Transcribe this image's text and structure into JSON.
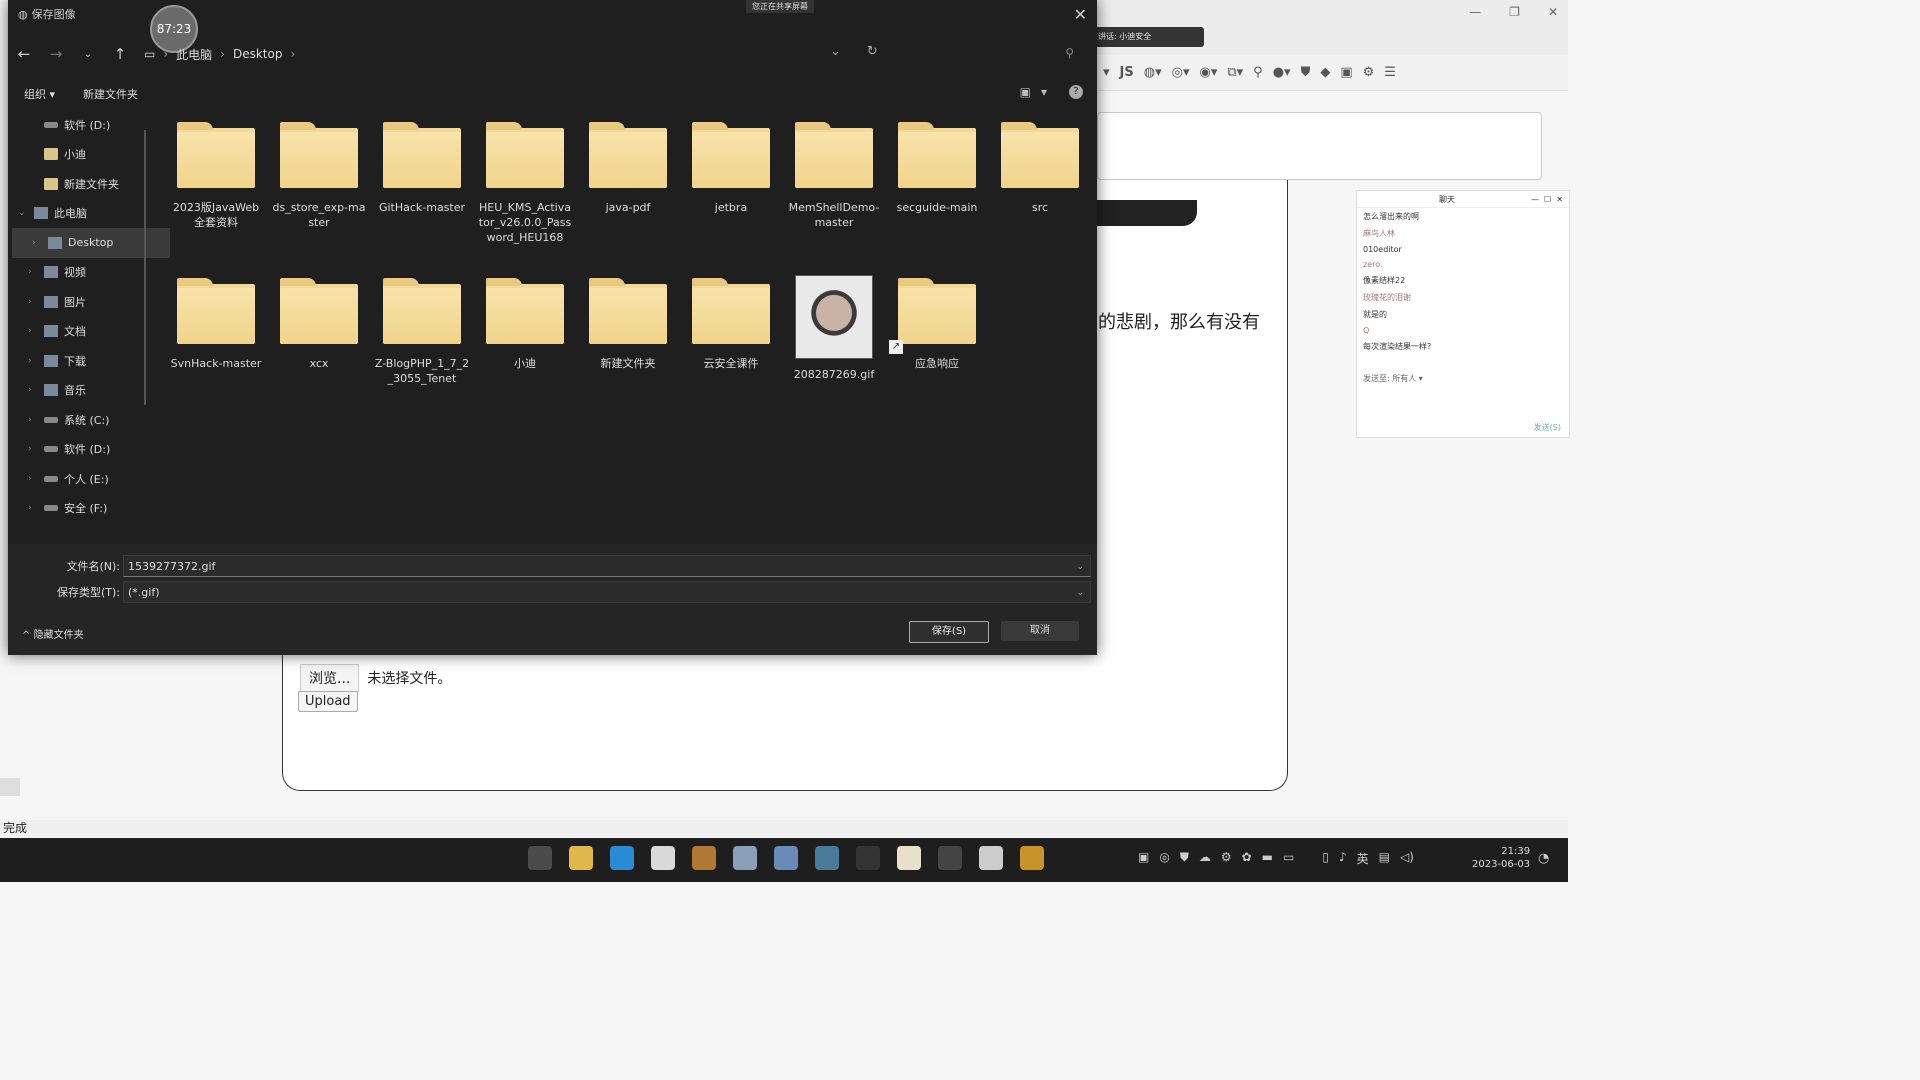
{
  "dialog": {
    "title": "保存图像",
    "timer": "87:23",
    "share_banner": "您正在共享屏幕",
    "breadcrumb": [
      "此电脑",
      "Desktop"
    ],
    "toolbar": {
      "organize": "组织 ▾",
      "new_folder": "新建文件夹"
    },
    "sidebar": [
      {
        "label": "软件 (D:)",
        "icon": "drive-icon",
        "indent": 1
      },
      {
        "label": "小迪",
        "icon": "folder-icon",
        "indent": 1
      },
      {
        "label": "新建文件夹",
        "icon": "folder-icon",
        "indent": 1
      },
      {
        "label": "此电脑",
        "icon": "computer-icon",
        "indent": 0,
        "expanded": true
      },
      {
        "label": "Desktop",
        "icon": "desktop-icon",
        "indent": 1,
        "selected": true
      },
      {
        "label": "视频",
        "icon": "video-icon",
        "indent": 1
      },
      {
        "label": "图片",
        "icon": "picture-icon",
        "indent": 1
      },
      {
        "label": "文档",
        "icon": "document-icon",
        "indent": 1
      },
      {
        "label": "下载",
        "icon": "download-icon",
        "indent": 1
      },
      {
        "label": "音乐",
        "icon": "music-icon",
        "indent": 1
      },
      {
        "label": "系统 (C:)",
        "icon": "drive-icon",
        "indent": 1
      },
      {
        "label": "软件 (D:)",
        "icon": "drive-icon",
        "indent": 1
      },
      {
        "label": "个人 (E:)",
        "icon": "drive-icon",
        "indent": 1
      },
      {
        "label": "安全 (F:)",
        "icon": "drive-icon",
        "indent": 1
      }
    ],
    "files": [
      {
        "name": "2023版JavaWeb全套资料",
        "type": "folder"
      },
      {
        "name": "ds_store_exp-master",
        "type": "folder"
      },
      {
        "name": "GitHack-master",
        "type": "folder"
      },
      {
        "name": "HEU_KMS_Activator_v26.0.0_Password_HEU168",
        "type": "folder"
      },
      {
        "name": "java-pdf",
        "type": "folder"
      },
      {
        "name": "jetbra",
        "type": "folder"
      },
      {
        "name": "MemShellDemo-master",
        "type": "folder"
      },
      {
        "name": "secguide-main",
        "type": "folder"
      },
      {
        "name": "src",
        "type": "folder"
      },
      {
        "name": "SvnHack-master",
        "type": "folder"
      },
      {
        "name": "xcx",
        "type": "folder"
      },
      {
        "name": "Z-BlogPHP_1_7_2_3055_Tenet",
        "type": "folder"
      },
      {
        "name": "小迪",
        "type": "folder"
      },
      {
        "name": "新建文件夹",
        "type": "folder"
      },
      {
        "name": "云安全课件",
        "type": "folder"
      },
      {
        "name": "208287269.gif",
        "type": "image"
      },
      {
        "name": "应急响应",
        "type": "shortcut-folder"
      }
    ],
    "filename_label": "文件名(N):",
    "filename_value": "1539277372.gif",
    "filetype_label": "保存类型(T):",
    "filetype_value": "(*.gif)",
    "hide_folders": "隐藏文件夹",
    "save_button": "保存(S)",
    "cancel_button": "取消"
  },
  "background": {
    "toolbar_js": "JS",
    "share_note": "正在讲话: 小迪安全",
    "body_text": "的悲剧，那么有没有",
    "browse_button": "浏览...",
    "no_file": "未选择文件。",
    "upload_button": "Upload",
    "status": "完成"
  },
  "chat": {
    "title": "聊天",
    "messages": [
      {
        "text": "怎么溜出来的啊",
        "muted": false
      },
      {
        "text": "麻鸟人林",
        "muted": true
      },
      {
        "text": "010editor",
        "muted": false
      },
      {
        "text": "zero.",
        "muted": true
      },
      {
        "text": "像素结样22",
        "muted": false
      },
      {
        "text": "玫瑰花的泪谢",
        "muted": true
      },
      {
        "text": "就是的",
        "muted": false
      },
      {
        "text": "Q",
        "muted": true
      },
      {
        "text": "每次渲染结果一样?",
        "muted": false
      }
    ],
    "send_to": "发送至:  所有人 ▾",
    "send_button": "发送(S)"
  },
  "taskbar": {
    "apps": [
      {
        "name": "windows-start-icon",
        "color": "#4a4a4a"
      },
      {
        "name": "file-explorer-icon",
        "color": "#e0b84a"
      },
      {
        "name": "edge-icon",
        "color": "#2a8ad4"
      },
      {
        "name": "chrome-icon",
        "color": "#d9d9d9"
      },
      {
        "name": "firefox-icon",
        "color": "#b07830"
      },
      {
        "name": "steam-icon",
        "color": "#8aa0b8"
      },
      {
        "name": "store-icon",
        "color": "#6a8ab8"
      },
      {
        "name": "photos-icon",
        "color": "#4a7a9a"
      },
      {
        "name": "app-generic-icon",
        "color": "#333333"
      },
      {
        "name": "java-icon",
        "color": "#e8e0c8"
      },
      {
        "name": "phpstorm-icon",
        "color": "#444444"
      },
      {
        "name": "shield-app-icon",
        "color": "#cccccc"
      },
      {
        "name": "sublime-icon",
        "color": "#c8942a"
      }
    ],
    "ime": "英",
    "time": "21:39",
    "date": "2023-06-03"
  }
}
